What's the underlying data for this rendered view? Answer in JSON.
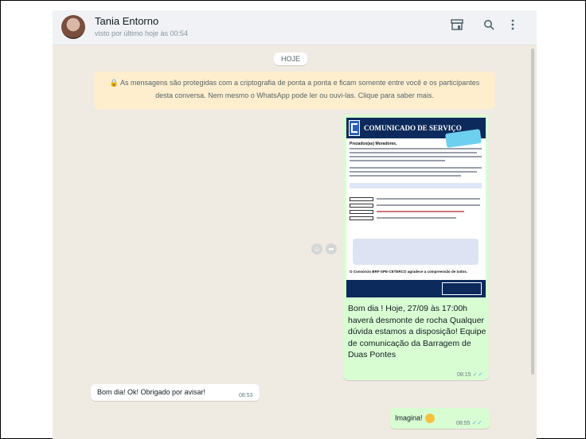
{
  "header": {
    "contact_name": "Tania Entorno",
    "last_seen": "visto por último hoje às 00:54",
    "icons": [
      "storefront-icon",
      "search-icon",
      "menu-icon"
    ]
  },
  "day_label": "HOJE",
  "encryption_notice": {
    "line1": "🔒 As mensagens são protegidas com a criptografia de ponta a ponta e ficam somente entre você e os participantes",
    "line2": "desta conversa. Nem mesmo o WhatsApp pode ler ou ouvi-las. Clique para saber mais."
  },
  "image_message": {
    "notice_title": "COMUNICADO DE SERVIÇO",
    "notice_salutation": "Prezados(as) Moradores,",
    "notice_closing": "O Consórcio BRF-SPE-CETERCO agradece a compreensão de todos.",
    "caption": "Bom dia ! Hoje, 27/09 às 17:00h haverá desmonte de rocha Qualquer dúvida estamos a disposição! Equipe de comunicação da Barragem de Duas Pontes",
    "time": "08:15"
  },
  "incoming_message": {
    "text": "Bom dia! Ok! Obrigado por avisar!",
    "time": "08:53"
  },
  "outgoing_message": {
    "text": "Imagina!",
    "time": "08:55"
  },
  "colors": {
    "chat_bg": "#efeae2",
    "outgoing_bubble": "#d9fdd3",
    "incoming_bubble": "#ffffff",
    "notice_bg": "#ffeecd",
    "read_tick": "#53bdeb"
  }
}
